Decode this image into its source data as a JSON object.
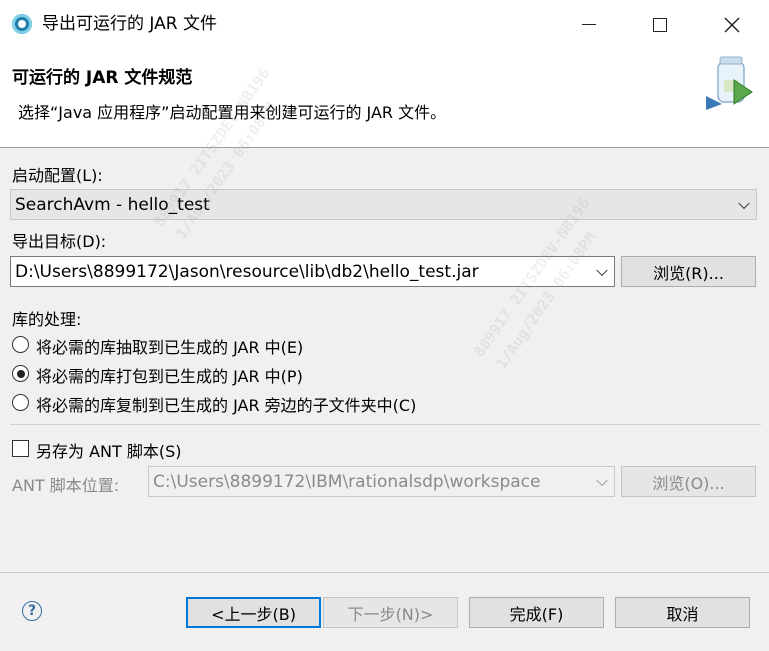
{
  "window": {
    "title": "导出可运行的 JAR 文件"
  },
  "header": {
    "title": "可运行的 JAR 文件规范",
    "description": "选择“Java 应用程序”启动配置用来创建可运行的 JAR 文件。"
  },
  "launch_config": {
    "label": "启动配置(L):",
    "value": "SearchAvm - hello_test"
  },
  "export_target": {
    "label": "导出目标(D):",
    "value": "D:\\Users\\8899172\\Jason\\resource\\lib\\db2\\hello_test.jar",
    "browse_label": "浏览(R)..."
  },
  "library_handling": {
    "label": "库的处理:",
    "options": [
      "将必需的库抽取到已生成的 JAR 中(E)",
      "将必需的库打包到已生成的 JAR 中(P)",
      "将必需的库复制到已生成的 JAR 旁边的子文件夹中(C)"
    ],
    "selected_index": 1
  },
  "ant": {
    "save_label": "另存为 ANT 脚本(S)",
    "checked": false,
    "location_label": "ANT 脚本位置:",
    "location_value": "C:\\Users\\8899172\\IBM\\rationalsdp\\workspace",
    "browse_label": "浏览(O)..."
  },
  "footer": {
    "help_symbol": "?",
    "back_label": "<上一步(B)",
    "next_label": "下一步(N)>",
    "finish_label": "完成(F)",
    "cancel_label": "取消"
  },
  "watermark": {
    "lines": [
      "889917 2ITSZDEV-NB196",
      "1/Aug/2023 06:08PM"
    ]
  },
  "colors": {
    "accent": "#0078d7",
    "dialog_bg": "#f0f0f0",
    "header_bg": "#ffffff"
  }
}
